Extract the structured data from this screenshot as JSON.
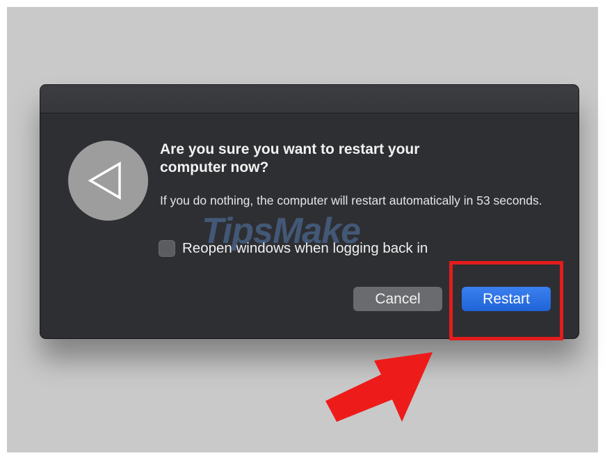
{
  "dialog": {
    "heading": "Are you sure you want to restart your computer now?",
    "message": "If you do nothing, the computer will restart automatically in 53 seconds.",
    "checkbox_label": "Reopen windows when logging back in",
    "checkbox_checked": false,
    "cancel_label": "Cancel",
    "restart_label": "Restart",
    "icon": "restart-triangle-icon"
  },
  "annotation": {
    "highlight_color": "#e31c1c",
    "arrow_color": "#ee1b1b"
  },
  "watermark": "TipsMake",
  "colors": {
    "dialog_bg": "#2e2f33",
    "primary_button": "#2b6ee0",
    "secondary_button": "#6a6b6f"
  }
}
